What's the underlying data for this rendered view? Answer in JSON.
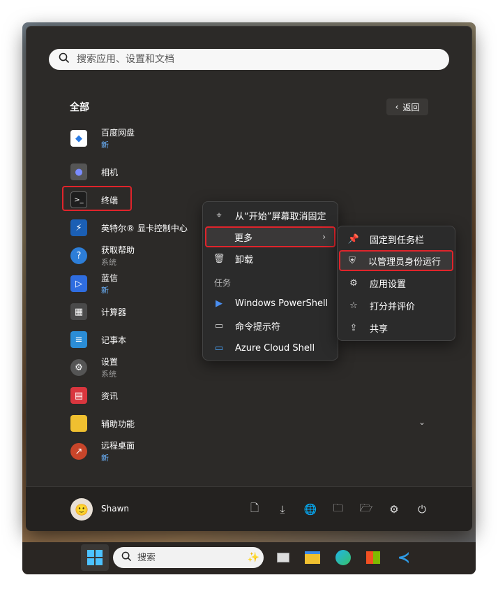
{
  "search": {
    "placeholder": "搜索应用、设置和文档"
  },
  "all_apps": {
    "title": "全部",
    "back_label": "返回"
  },
  "apps": [
    {
      "name": "百度网盘",
      "sub": "新",
      "sub_type": "new",
      "icon": "baidu-netdisk-icon"
    },
    {
      "name": "相机",
      "sub": "",
      "sub_type": "",
      "icon": "camera-icon"
    },
    {
      "name": "终端",
      "sub": "",
      "sub_type": "",
      "icon": "terminal-icon"
    },
    {
      "name": "英特尔® 显卡控制中心",
      "sub": "",
      "sub_type": "",
      "icon": "intel-graphics-icon"
    },
    {
      "name": "获取帮助",
      "sub": "系统",
      "sub_type": "system",
      "icon": "get-help-icon"
    },
    {
      "name": "蓝信",
      "sub": "新",
      "sub_type": "new",
      "icon": "lanxin-icon"
    },
    {
      "name": "计算器",
      "sub": "",
      "sub_type": "",
      "icon": "calculator-icon"
    },
    {
      "name": "记事本",
      "sub": "",
      "sub_type": "",
      "icon": "notepad-icon"
    },
    {
      "name": "设置",
      "sub": "系统",
      "sub_type": "system",
      "icon": "settings-icon"
    },
    {
      "name": "资讯",
      "sub": "",
      "sub_type": "",
      "icon": "news-icon"
    },
    {
      "name": "辅助功能",
      "sub": "",
      "sub_type": "",
      "icon": "folder-icon"
    },
    {
      "name": "远程桌面",
      "sub": "新",
      "sub_type": "new",
      "icon": "remote-desktop-icon"
    }
  ],
  "context_menu": {
    "unpin": "从“开始”屏幕取消固定",
    "more": "更多",
    "uninstall": "卸载",
    "tasks_label": "任务",
    "tasks": [
      "Windows PowerShell",
      "命令提示符",
      "Azure Cloud Shell"
    ]
  },
  "submenu": {
    "items": [
      "固定到任务栏",
      "以管理员身份运行",
      "应用设置",
      "打分并评价",
      "共享"
    ]
  },
  "user": {
    "name": "Shawn"
  },
  "taskbar": {
    "search_placeholder": "搜索"
  },
  "colors": {
    "highlight": "#e0242b",
    "new_badge": "#6cb4ff"
  }
}
